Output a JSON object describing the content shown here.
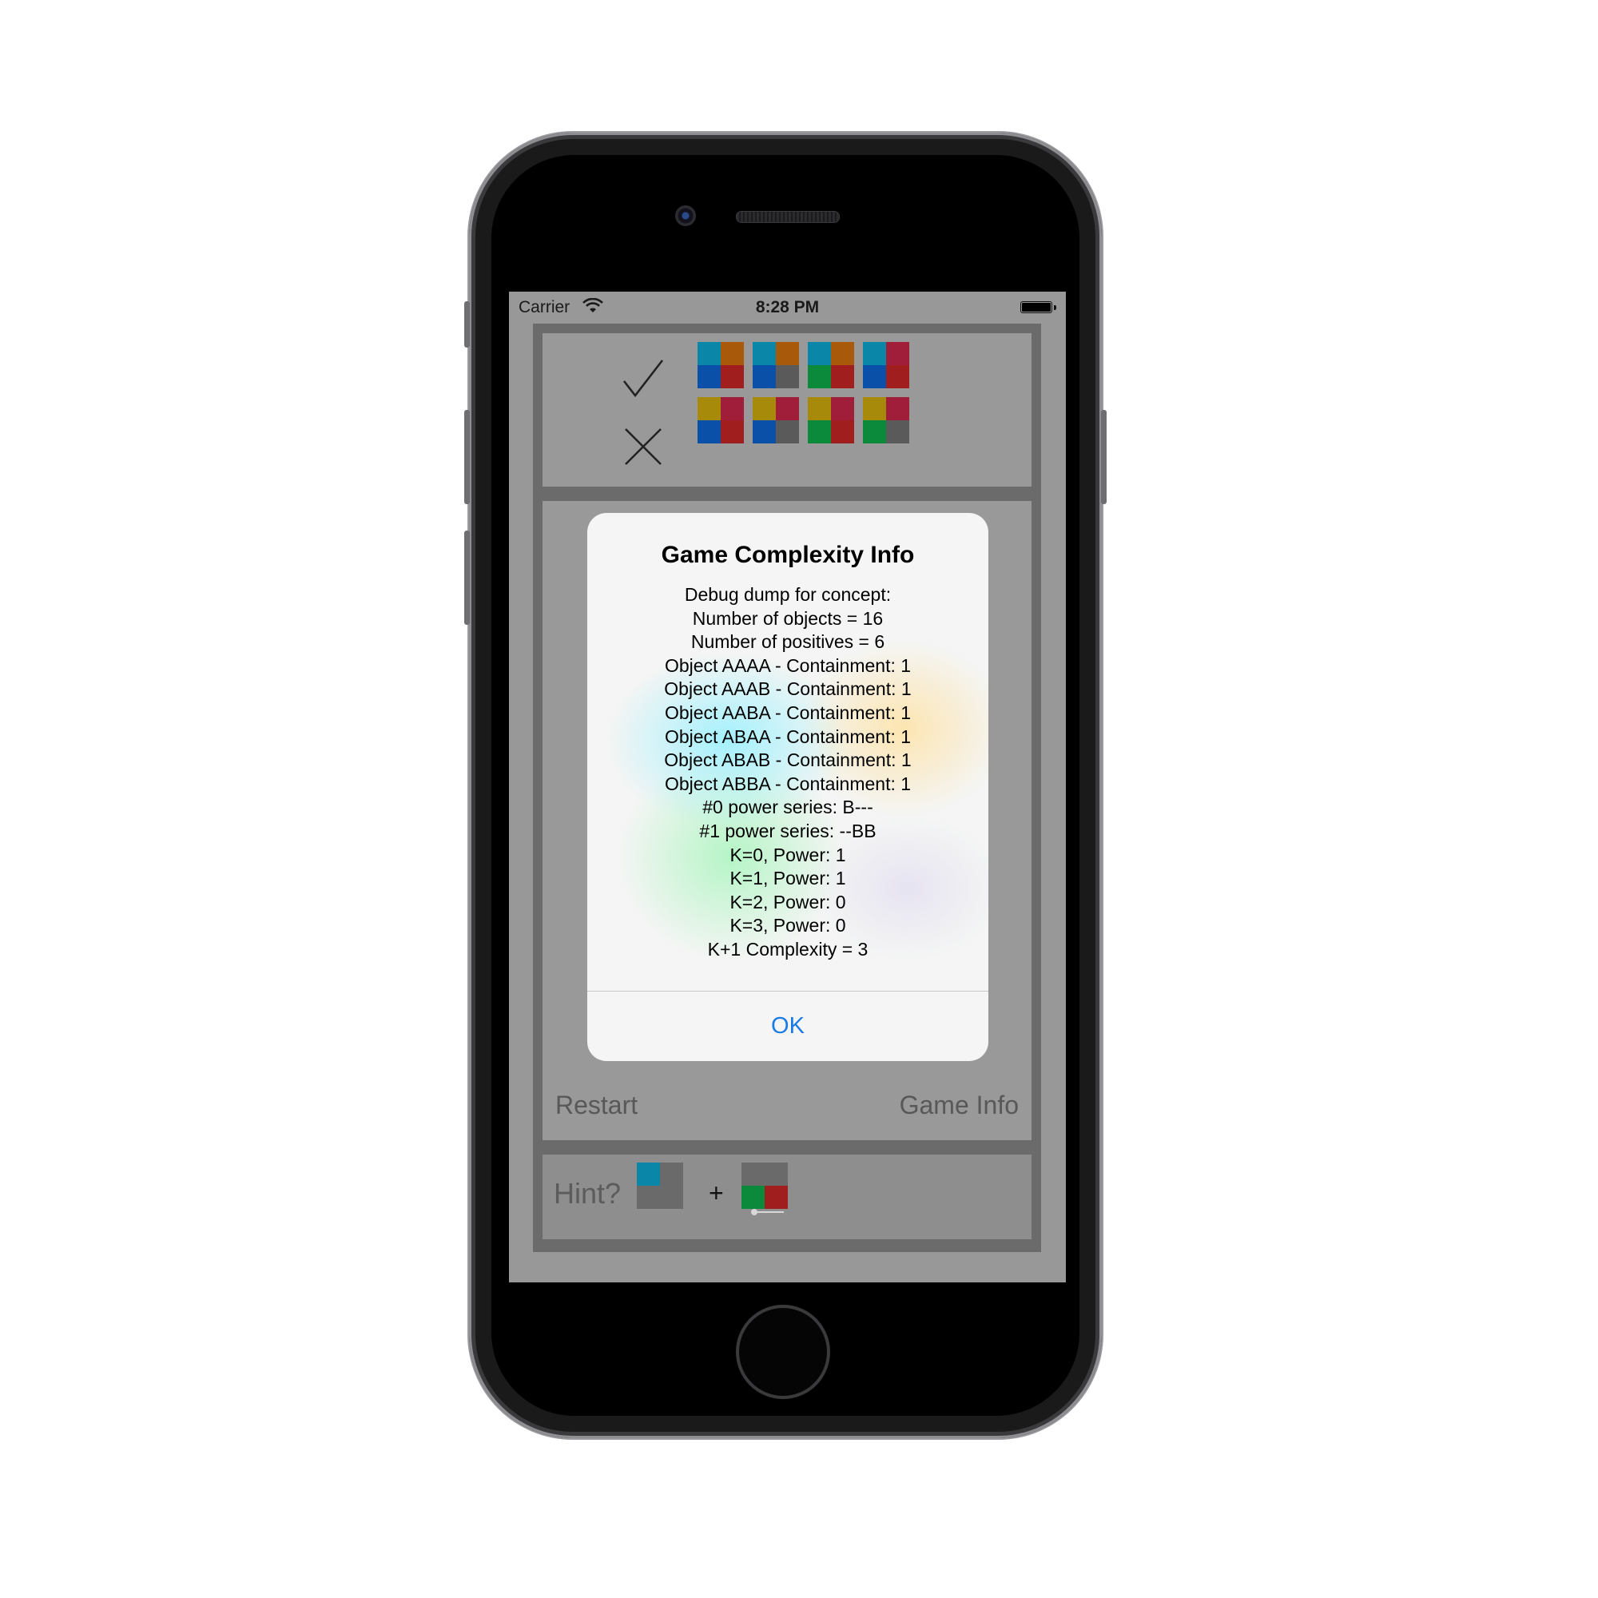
{
  "status_bar": {
    "carrier": "Carrier",
    "time": "8:28 PM"
  },
  "board": {
    "positive_icon": "check-icon",
    "negative_icon": "x-icon",
    "positive_row": [
      [
        "#0a87a8",
        "#a85a0a",
        "#0a50a8",
        "#a01e1e"
      ],
      [
        "#0a87a8",
        "#a85a0a",
        "#0a50a8",
        "#5a5a5a"
      ],
      [
        "#0a87a8",
        "#a85a0a",
        "#0a8a3a",
        "#a01e1e"
      ],
      [
        "#0a87a8",
        "#a01e3a",
        "#0a50a8",
        "#a01e1e"
      ]
    ],
    "negative_row": [
      [
        "#a88a0a",
        "#a01e3a",
        "#0a50a8",
        "#a01e1e"
      ],
      [
        "#a88a0a",
        "#a01e3a",
        "#0a50a8",
        "#5a5a5a"
      ],
      [
        "#a88a0a",
        "#a01e3a",
        "#0a8a3a",
        "#a01e1e"
      ],
      [
        "#a88a0a",
        "#a01e3a",
        "#0a8a3a",
        "#5a5a5a"
      ]
    ]
  },
  "controls": {
    "restart_label": "Restart",
    "game_info_label": "Game Info"
  },
  "hint": {
    "label": "Hint?",
    "plus": "+",
    "tile_a": [
      "#0a87a8",
      "#6a6a6a",
      "#6a6a6a",
      "#6a6a6a"
    ],
    "tile_b": [
      "#6a6a6a",
      "#6a6a6a",
      "#0a8a3a",
      "#a01e1e"
    ]
  },
  "alert": {
    "title": "Game Complexity Info",
    "lines": [
      "Debug dump for concept:",
      "Number of objects = 16",
      "Number of positives = 6",
      "Object AAAA - Containment: 1",
      "Object AAAB - Containment: 1",
      "Object AABA - Containment: 1",
      "Object ABAA - Containment: 1",
      "Object ABAB - Containment: 1",
      "Object ABBA - Containment: 1",
      "#0 power series: B---",
      "#1 power series: --BB",
      "K=0, Power: 1",
      "K=1, Power: 1",
      "K=2, Power: 0",
      "K=3, Power: 0",
      "K+1 Complexity = 3"
    ],
    "ok_label": "OK"
  },
  "colors": {
    "accent": "#1a7ae6",
    "screen_bg": "#989898",
    "frame": "#6b6b6b"
  }
}
